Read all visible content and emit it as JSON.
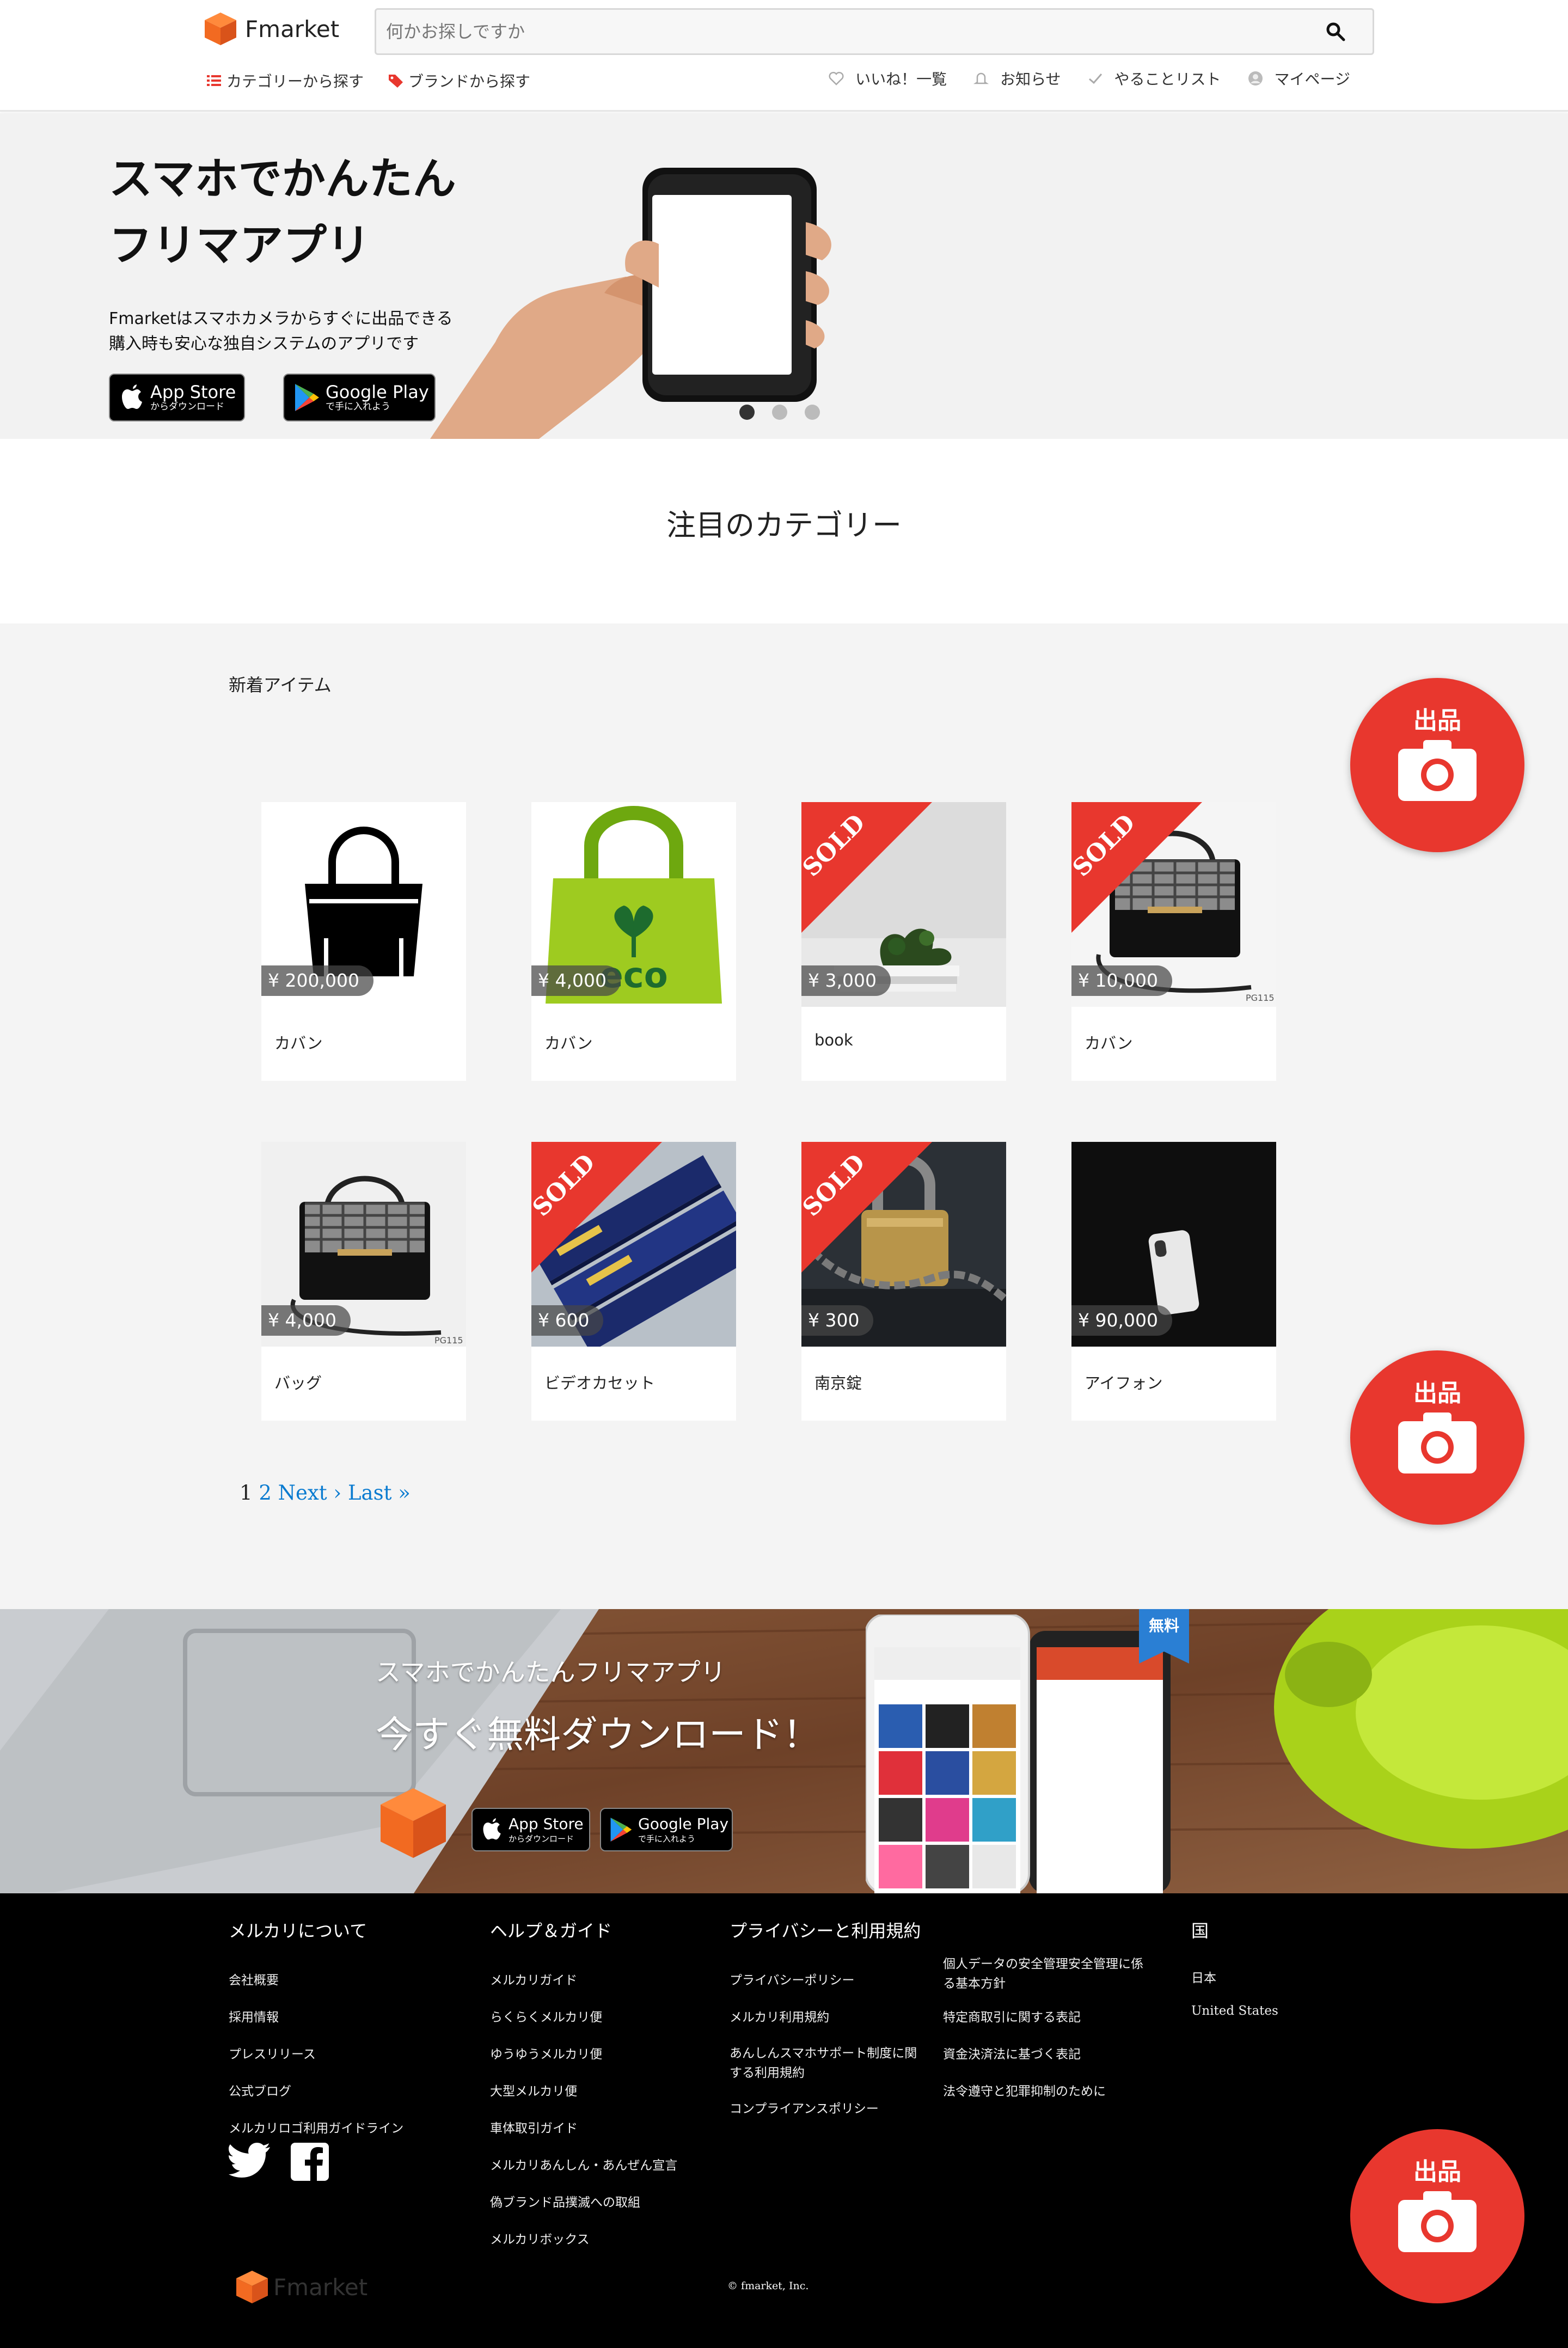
{
  "header": {
    "logo_text": "Fmarket",
    "search_placeholder": "何かお探しですか",
    "nav_left": [
      "カテゴリーから探す",
      "ブランドから探す"
    ],
    "nav_right": [
      "いいね！一覧",
      "お知らせ",
      "やることリスト",
      "マイページ"
    ]
  },
  "hero": {
    "title_line1": "スマホでかんたん",
    "title_line2": "フリマアプリ",
    "desc_line1": "Fmarketはスマホカメラからすぐに出品できる",
    "desc_line2": "購入時も安心な独自システムのアプリです",
    "appstore_small": "からダウンロード",
    "appstore_large": "App Store",
    "googleplay_small": "で手に入れよう",
    "googleplay_large": "Google Play",
    "slide_count": 3,
    "active_slide": 1
  },
  "featured_heading": "注目のカテゴリー",
  "items_section": {
    "title": "新着アイテム",
    "items": [
      {
        "price": "¥ 200,000",
        "name": "カバン",
        "sold": false,
        "image": "black-handbag-icon"
      },
      {
        "price": "¥ 4,000",
        "name": "カバン",
        "sold": false,
        "image": "eco-bag"
      },
      {
        "price": "¥ 3,000",
        "name": "book",
        "sold": true,
        "image": "books-with-plant"
      },
      {
        "price": "¥ 10,000",
        "name": "カバン",
        "sold": true,
        "image": "plaid-handbag"
      },
      {
        "price": "¥ 4,000",
        "name": "バッグ",
        "sold": false,
        "image": "plaid-handbag"
      },
      {
        "price": "¥ 600",
        "name": "ビデオカセット",
        "sold": true,
        "image": "video-cassettes"
      },
      {
        "price": "¥ 300",
        "name": "南京錠",
        "sold": true,
        "image": "padlock-chain"
      },
      {
        "price": "¥ 90,000",
        "name": "アイフォン",
        "sold": false,
        "image": "white-smartphone"
      }
    ],
    "sold_label": "SOLD",
    "pagination": {
      "current": "1",
      "next_page": "2",
      "next": "Next ›",
      "last": "Last »"
    }
  },
  "fab": {
    "label": "出品"
  },
  "download_banner": {
    "subtitle": "スマホでかんたんフリマアプリ",
    "title": "今すぐ無料ダウンロード！",
    "free_badge": "無料",
    "appstore_small": "からダウンロード",
    "appstore_large": "App Store",
    "googleplay_small": "で手に入れよう",
    "googleplay_large": "Google Play"
  },
  "footer": {
    "col1": {
      "head": "メルカリについて",
      "links": [
        "会社概要",
        "採用情報",
        "プレスリリース",
        "公式ブログ",
        "メルカリロゴ利用ガイドライン"
      ]
    },
    "col2": {
      "head": "ヘルプ＆ガイド",
      "links": [
        "メルカリガイド",
        "らくらくメルカリ便",
        "ゆうゆうメルカリ便",
        "大型メルカリ便",
        "車体取引ガイド",
        "メルカリあんしん・あんぜん宣言",
        "偽ブランド品撲滅への取組",
        "メルカリボックス"
      ]
    },
    "col3": {
      "head": "プライバシーと利用規約",
      "links": [
        "プライバシーポリシー",
        "メルカリ利用規約",
        "あんしんスマホサポート制度に関する利用規約",
        "コンプライアンスポリシー"
      ]
    },
    "col4": {
      "links": [
        "個人データの安全管理安全管理に係る基本方針",
        "特定商取引に関する表記",
        "資金決済法に基づく表記",
        "法令遵守と犯罪抑制のために"
      ]
    },
    "col5": {
      "head": "国",
      "links": [
        "日本",
        "United States"
      ]
    },
    "logo_text": "Fmarket",
    "copyright": "© fmarket, Inc."
  },
  "colors": {
    "accent": "#e8372e",
    "logo_orange": "#f26a21",
    "link_blue": "#0a7bd0",
    "footer_bg": "#000000"
  }
}
